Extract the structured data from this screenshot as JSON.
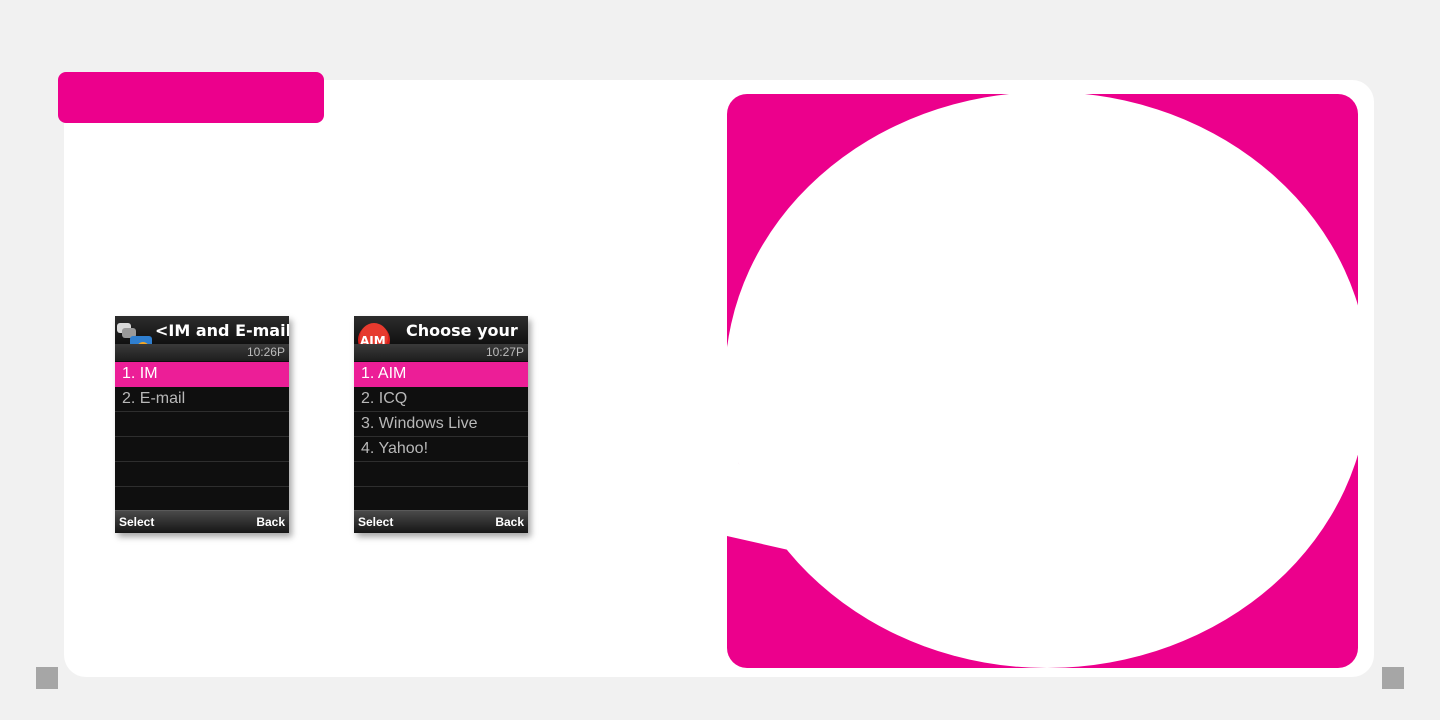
{
  "colors": {
    "brand_magenta": "#ec008c",
    "selection_pink": "#ec1e97",
    "background": "#f1f1f1",
    "card": "#ffffff",
    "marker_gray": "#a6a6a6"
  },
  "screens": [
    {
      "title_left_arrow": "<",
      "title": "IM and E-mail",
      "title_right_arrow": ">",
      "icon": "im-email-icon",
      "time": "10:26P",
      "items": [
        "1. IM",
        "2. E-mail",
        "",
        "",
        "",
        ""
      ],
      "selected_index": 0,
      "softkey_left": "Select",
      "softkey_right": "Back"
    },
    {
      "title": "Choose your",
      "icon": "aim-icon",
      "icon_text": "AIM",
      "time": "10:27P",
      "items": [
        "1. AIM",
        "2. ICQ",
        "3. Windows Live",
        "4. Yahoo!",
        "",
        ""
      ],
      "selected_index": 0,
      "softkey_left": "Select",
      "softkey_right": "Back"
    }
  ]
}
